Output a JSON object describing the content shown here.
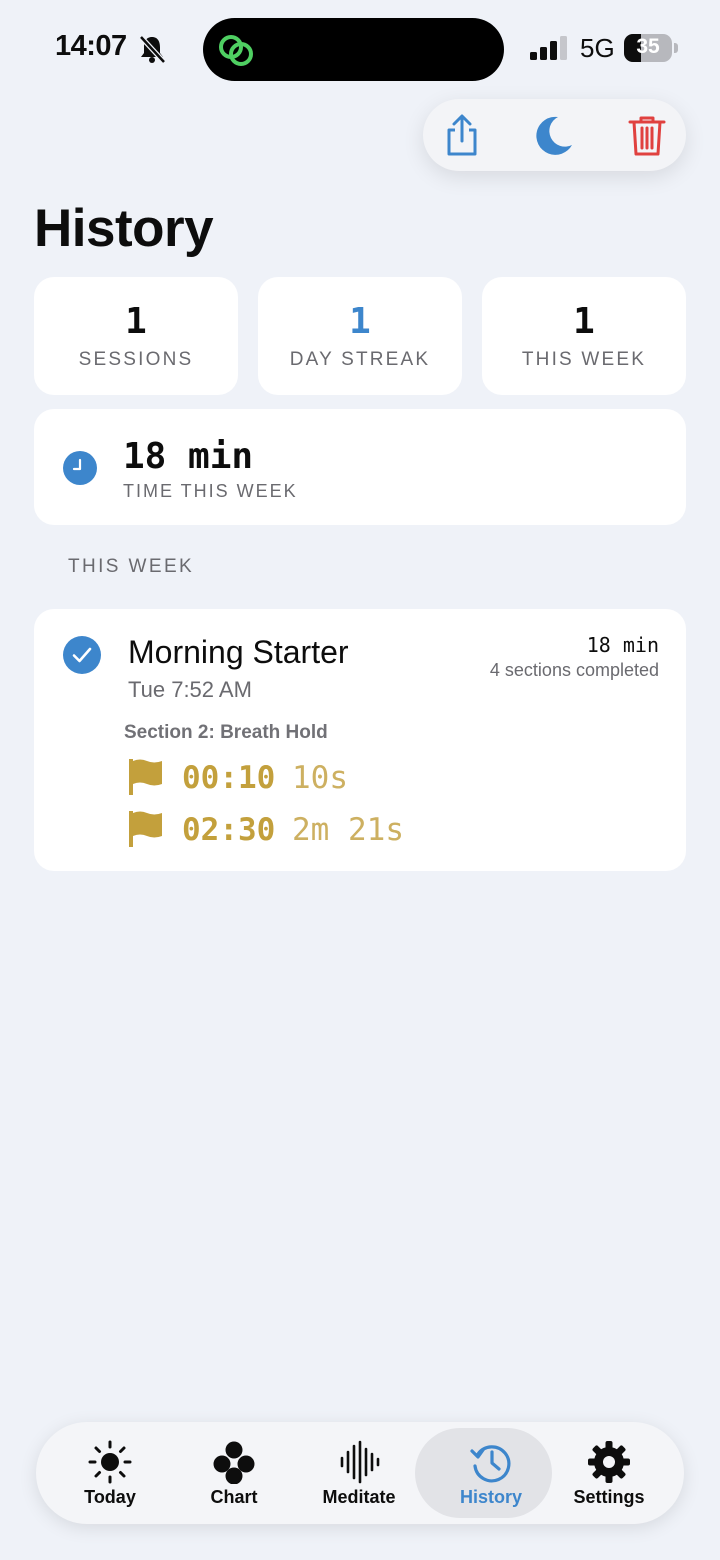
{
  "status_bar": {
    "time": "14:07",
    "network": "5G",
    "battery": "35"
  },
  "title": "History",
  "stats": [
    {
      "value": "1",
      "label": "SESSIONS",
      "color": "#0d0d0d"
    },
    {
      "value": "1",
      "label": "DAY STREAK",
      "color": "#3d86cc"
    },
    {
      "value": "1",
      "label": "THIS WEEK",
      "color": "#0d0d0d"
    }
  ],
  "time_this_week": {
    "value": "18 min",
    "label": "TIME THIS WEEK"
  },
  "section_header": "THIS WEEK",
  "session": {
    "name": "Morning Starter",
    "date": "Tue 7:52 AM",
    "duration": "18 min",
    "summary": "4 sections completed",
    "section_label": "Section 2: Breath Hold",
    "marks": [
      {
        "time": "00:10",
        "duration": "10s"
      },
      {
        "time": "02:30",
        "duration": "2m 21s"
      }
    ]
  },
  "tabs": [
    {
      "label": "Today",
      "icon": "sun-icon"
    },
    {
      "label": "Chart",
      "icon": "dots-icon"
    },
    {
      "label": "Meditate",
      "icon": "waveform-icon"
    },
    {
      "label": "History",
      "icon": "history-icon",
      "active": true
    },
    {
      "label": "Settings",
      "icon": "gear-icon"
    }
  ],
  "colors": {
    "accent": "#3d86cc",
    "destructive": "#e0413f",
    "gold": "#c3a03c",
    "background": "#eff2f8"
  }
}
